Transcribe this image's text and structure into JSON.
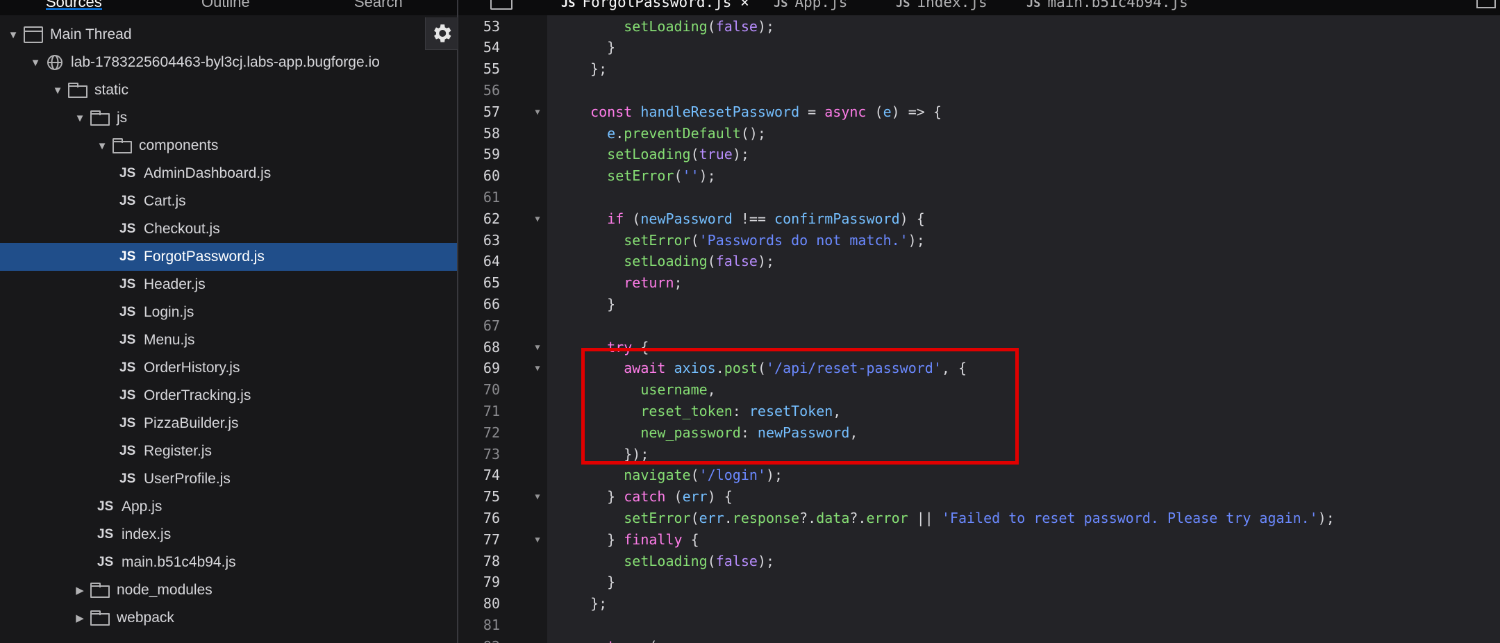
{
  "top_tabs": {
    "sources": "Sources",
    "outline": "Outline",
    "search": "Search"
  },
  "editor_tabs": [
    {
      "label": "ForgotPassword.js",
      "suffix": "×",
      "active": true
    },
    {
      "label": "App.js",
      "active": false
    },
    {
      "label": "index.js",
      "active": false
    },
    {
      "label": "main.b51c4b94.js",
      "active": false
    }
  ],
  "tree": {
    "thread": "Main Thread",
    "host": "lab-1783225604463-byl3cj.labs-app.bugforge.io",
    "static": "static",
    "js": "js",
    "components": "components",
    "component_files": [
      "AdminDashboard.js",
      "Cart.js",
      "Checkout.js",
      "ForgotPassword.js",
      "Header.js",
      "Login.js",
      "Menu.js",
      "OrderHistory.js",
      "OrderTracking.js",
      "PizzaBuilder.js",
      "Register.js",
      "UserProfile.js"
    ],
    "selected_file": "ForgotPassword.js",
    "js_files": [
      "App.js",
      "index.js",
      "main.b51c4b94.js"
    ],
    "node_modules": "node_modules",
    "webpack": "webpack",
    "js_badge": "JS"
  },
  "code": {
    "first_line": 53,
    "lines": [
      "      setLoading(false);",
      "    }",
      "  };",
      "",
      "  const handleResetPassword = async (e) => {",
      "    e.preventDefault();",
      "    setLoading(true);",
      "    setError('');",
      "",
      "    if (newPassword !== confirmPassword) {",
      "      setError('Passwords do not match.');",
      "      setLoading(false);",
      "      return;",
      "    }",
      "",
      "    try {",
      "      await axios.post('/api/reset-password', {",
      "        username,",
      "        reset_token: resetToken,",
      "        new_password: newPassword,",
      "      });",
      "      navigate('/login');",
      "    } catch (err) {",
      "      setError(err.response?.data?.error || 'Failed to reset password. Please try again.');",
      "    } finally {",
      "      setLoading(false);",
      "    }",
      "  };",
      "",
      "  return ("
    ],
    "foldable_lines": [
      57,
      62,
      68,
      69,
      75,
      77
    ],
    "bright_lines": [
      53,
      54,
      55,
      57,
      58,
      59,
      60,
      62,
      63,
      64,
      65,
      66,
      68,
      69,
      74,
      75,
      76,
      77,
      78,
      79,
      80
    ]
  },
  "colors": {
    "keyword": "#ff7de9",
    "function": "#86de74",
    "string": "#6b89ff",
    "variable": "#75bfff",
    "selection": "#204e8a",
    "highlight_box": "#e00000"
  }
}
